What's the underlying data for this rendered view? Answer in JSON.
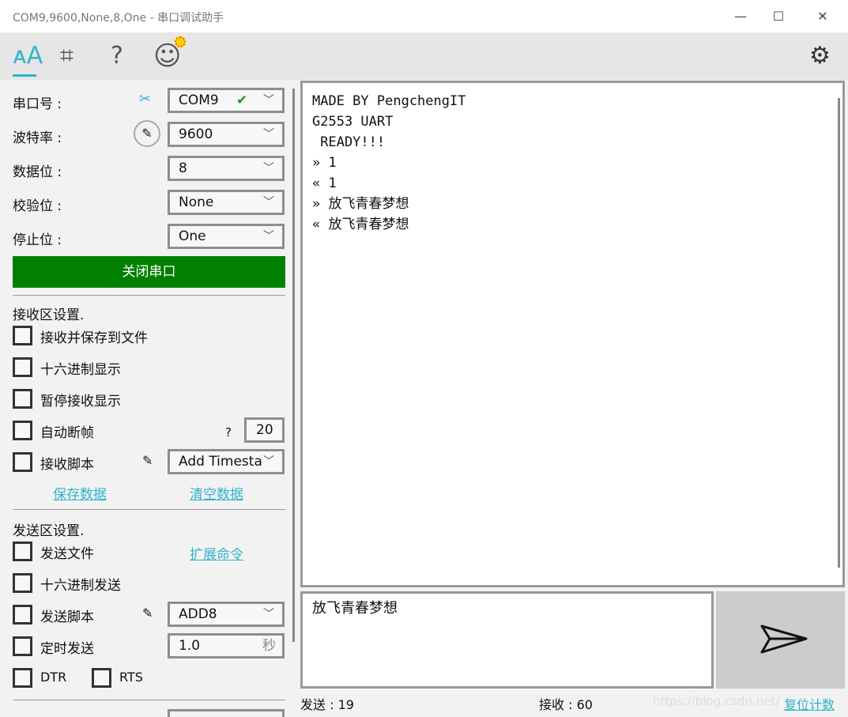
{
  "window": {
    "title": "COM9,9600,None,8,One - 串口调试助手",
    "min": "—",
    "max": "☐",
    "close": "✕"
  },
  "toolbar": {
    "font_icon": "ᴀA",
    "crop_icon": "⌗",
    "help_icon": "?",
    "smile_icon": "☺",
    "settings_icon": "⚙"
  },
  "serial": {
    "port_label": "串口号 :",
    "port_value": "COM9",
    "port_ok": "✔",
    "baud_label": "波特率 :",
    "baud_value": "9600",
    "data_label": "数据位 :",
    "data_value": "8",
    "parity_label": "校验位 :",
    "parity_value": "None",
    "stop_label": "停止位 :",
    "stop_value": "One",
    "close_button": "关闭串口"
  },
  "receive_settings": {
    "title": "接收区设置.",
    "options": [
      "接收并保存到文件",
      "十六进制显示",
      "暂停接收显示",
      "自动断帧",
      "接收脚本"
    ],
    "frame_help": "?",
    "frame_value": "20",
    "script_value": "Add Timesta",
    "save_link": "保存数据",
    "clear_link": "清空数据"
  },
  "send_settings": {
    "title": "发送区设置.",
    "options": [
      "发送文件",
      "十六进制发送",
      "发送脚本",
      "定时发送"
    ],
    "ext_link": "扩展命令",
    "script_value": "ADD8",
    "interval_value": "1.0",
    "interval_unit": "秒",
    "dtr": "DTR",
    "rts": "RTS"
  },
  "receive_text": [
    "MADE BY PengchengIT",
    "G2553 UART",
    " READY!!!",
    "» 1",
    "« 1",
    "» 放飞青春梦想",
    "« 放飞青春梦想"
  ],
  "send_text": "放飞青春梦想",
  "status": {
    "sent": "发送 : 19",
    "received": "接收 : 60",
    "reset_link": "复位计数",
    "watermark": "https://blog.csdn.net/pen"
  }
}
